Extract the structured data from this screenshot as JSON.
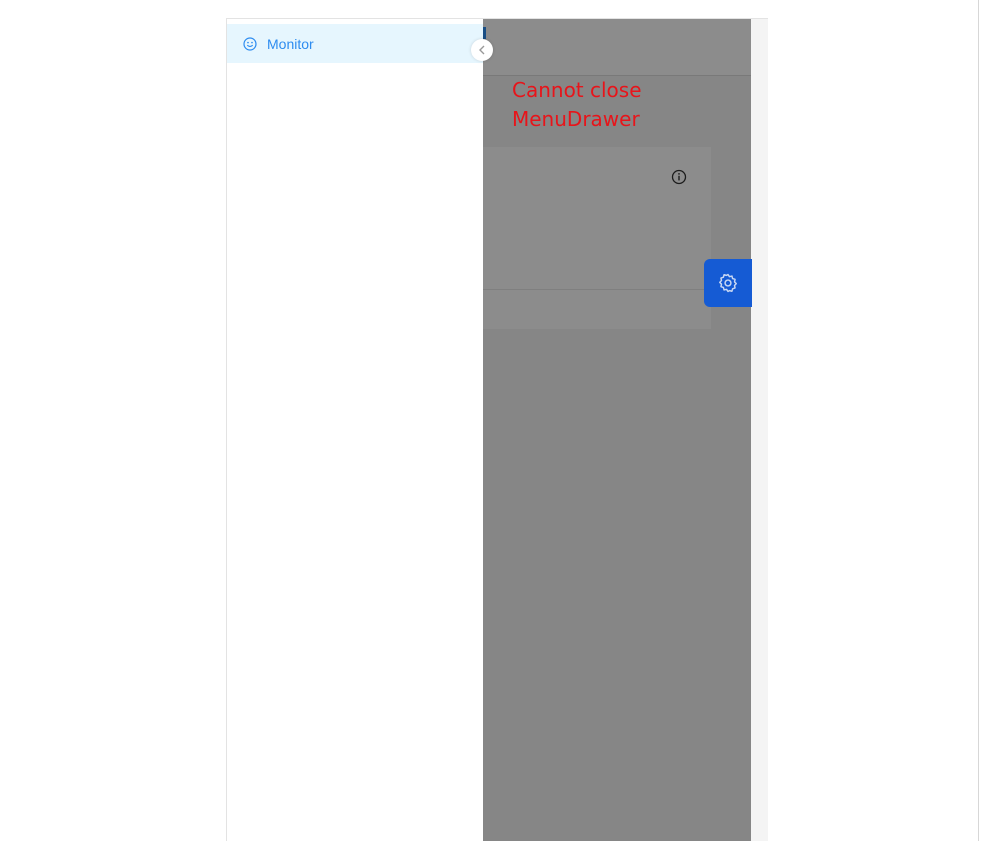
{
  "menu": {
    "items": [
      {
        "label": "Monitor",
        "icon": "smile-icon",
        "active": true
      }
    ]
  },
  "annotation": {
    "text": "Cannot close\nMenuDrawer"
  },
  "colors": {
    "menu_active_bg": "#e6f6fe",
    "menu_active_text": "#2d8cf0",
    "annotation_text": "#e8141a",
    "settings_button_bg": "#155bd4",
    "mask": "rgba(0,0,0,0.45)"
  },
  "icons": {
    "info": "info-icon",
    "settings": "gear-icon",
    "scroll_grip": "scrollbar-grip"
  }
}
